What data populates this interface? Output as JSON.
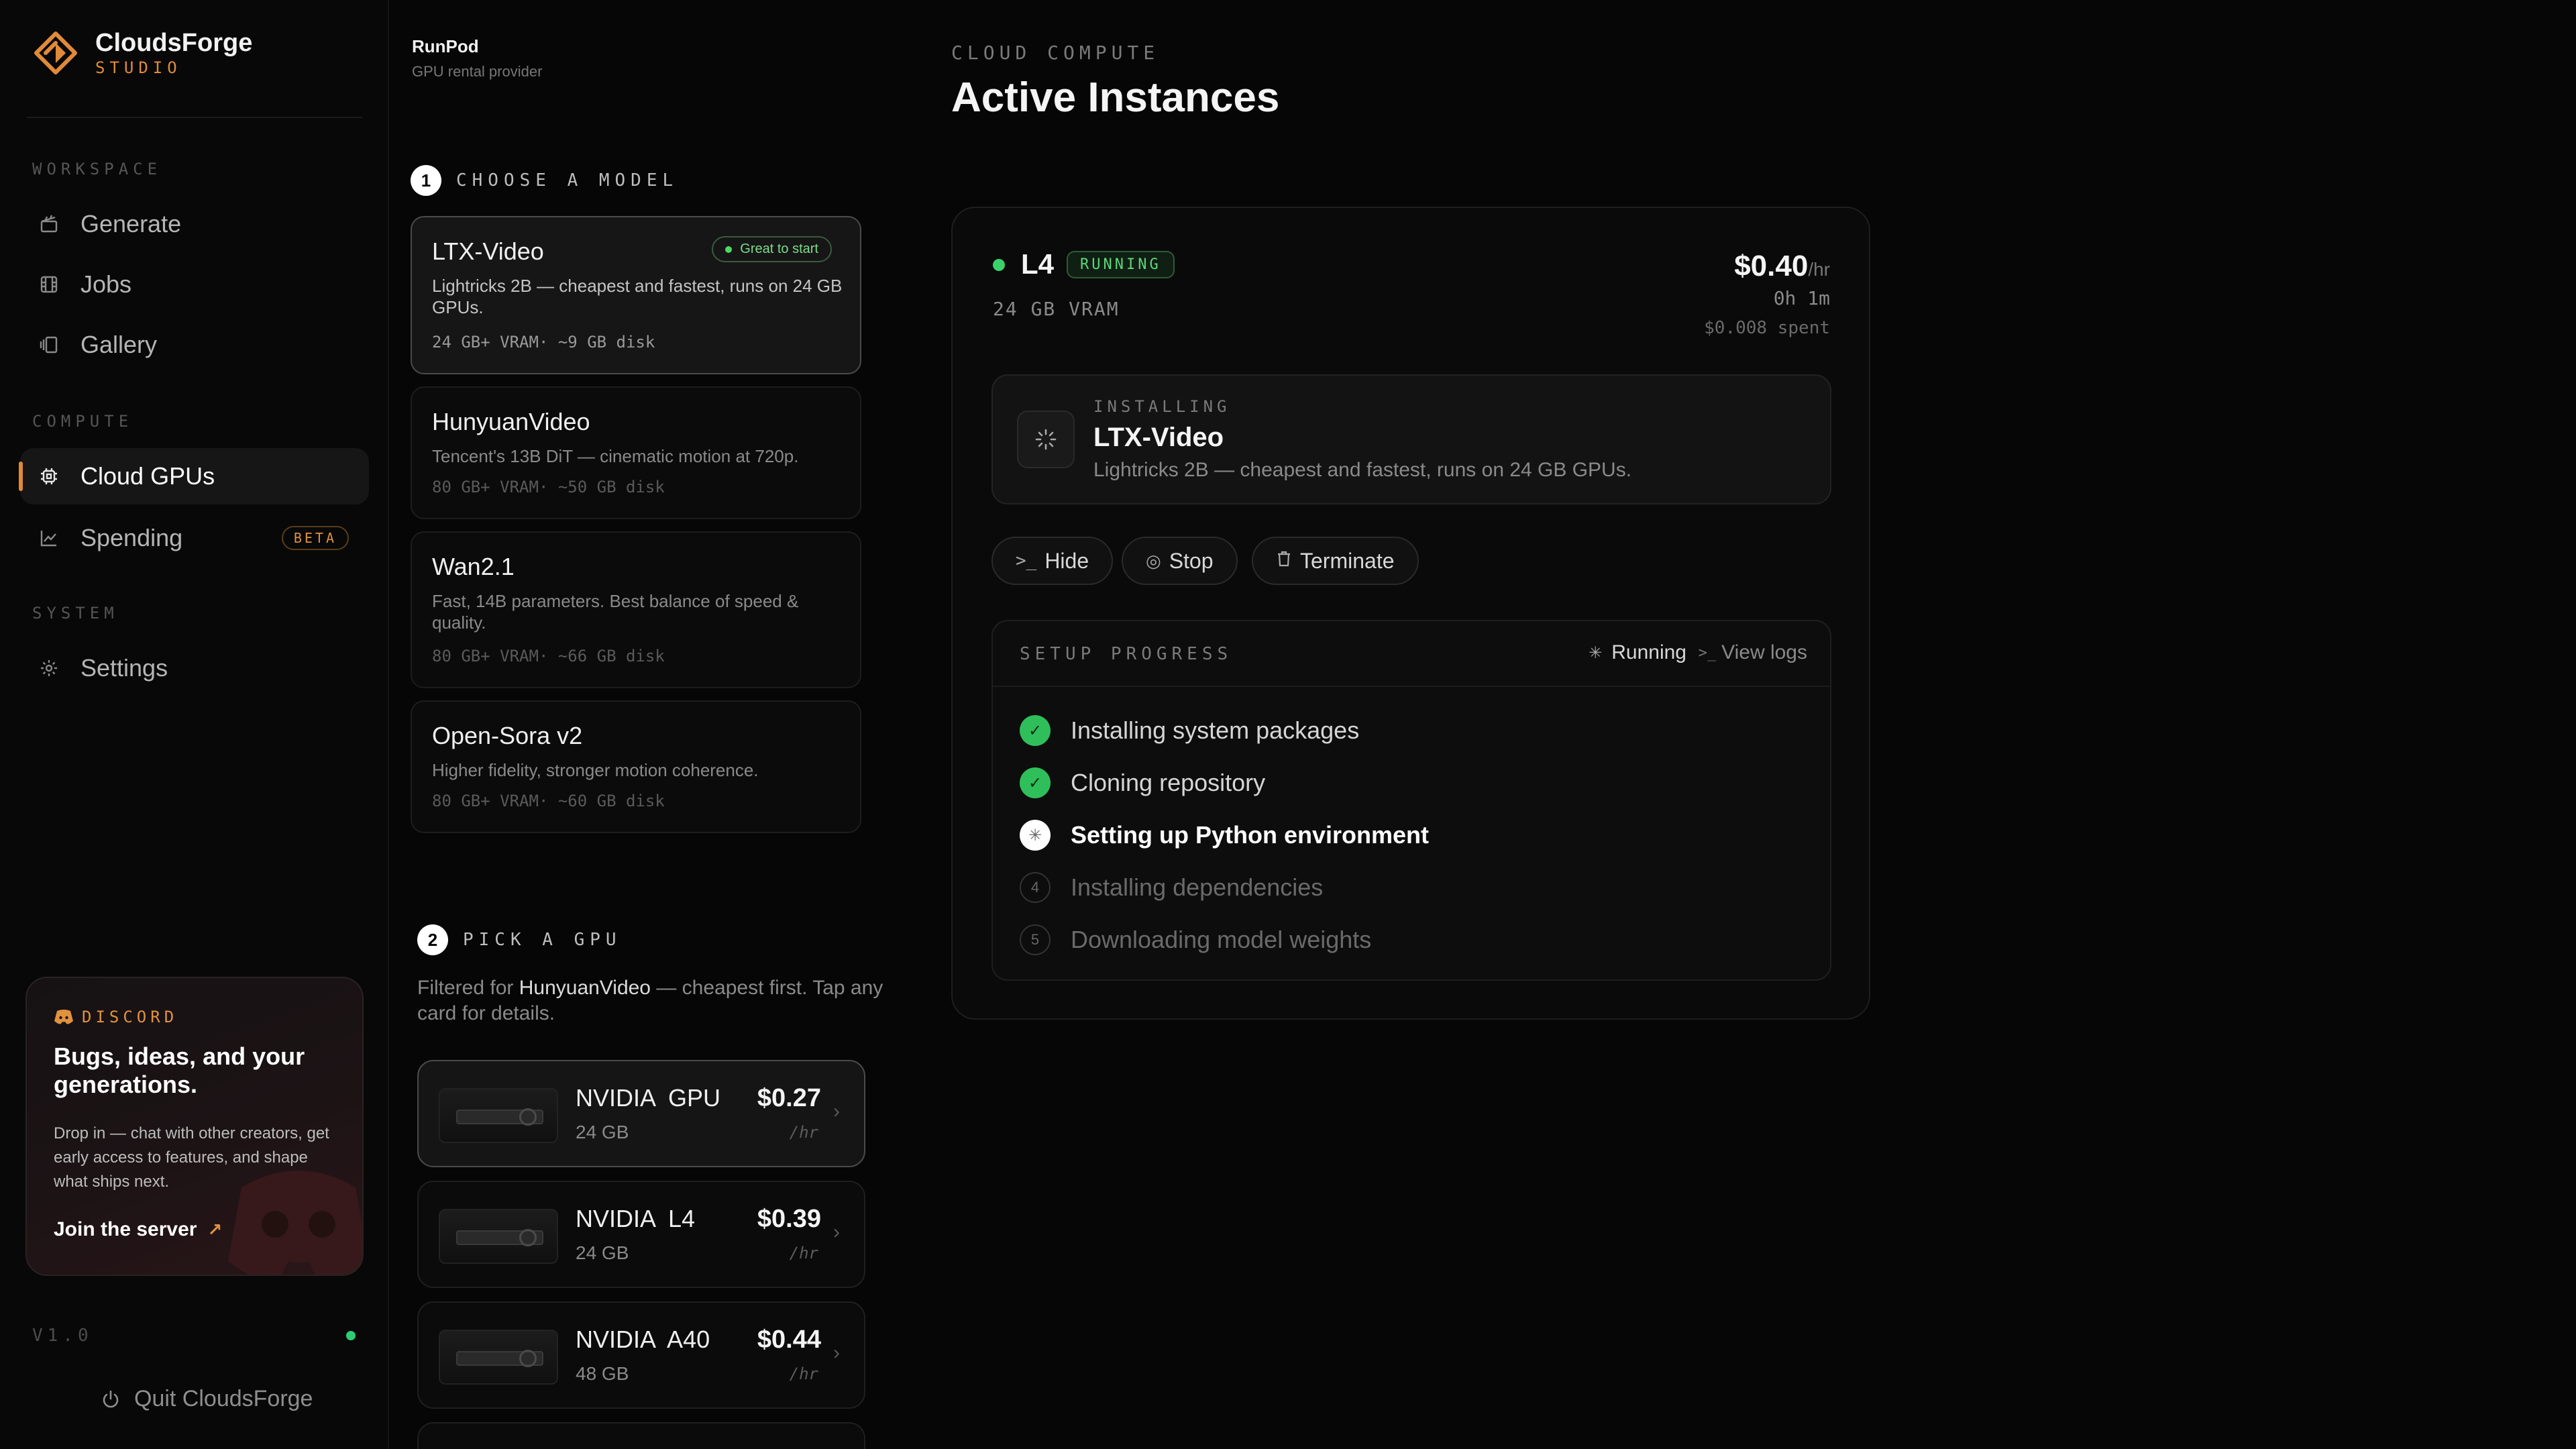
{
  "brand": {
    "name": "CloudsForge",
    "sub": "STUDIO"
  },
  "nav": {
    "workspace_label": "WORKSPACE",
    "generate": "Generate",
    "jobs": "Jobs",
    "gallery": "Gallery",
    "compute_label": "COMPUTE",
    "cloud_gpus": "Cloud GPUs",
    "spending": "Spending",
    "spending_badge": "BETA",
    "system_label": "SYSTEM",
    "settings": "Settings"
  },
  "discord": {
    "tag": "DISCORD",
    "title": "Bugs, ideas, and your generations.",
    "body": "Drop in — chat with other creators, get early access to features, and shape what ships next.",
    "cta": "Join the server"
  },
  "footer": {
    "version": "V1.0",
    "quit": "Quit CloudsForge"
  },
  "provider": {
    "name": "RunPod",
    "sub": "GPU rental provider"
  },
  "step1": {
    "num": "1",
    "label": "CHOOSE A MODEL"
  },
  "models": [
    {
      "name": "LTX-Video",
      "badge": "Great to start",
      "desc": "Lightricks 2B — cheapest and fastest, runs on 24 GB GPUs.",
      "spec": "24 GB+ VRAM· ~9 GB disk"
    },
    {
      "name": "HunyuanVideo",
      "desc": "Tencent's 13B DiT — cinematic motion at 720p.",
      "spec": "80 GB+ VRAM· ~50 GB disk"
    },
    {
      "name": "Wan2.1",
      "desc": "Fast, 14B parameters. Best balance of speed & quality.",
      "spec": "80 GB+ VRAM· ~66 GB disk"
    },
    {
      "name": "Open-Sora v2",
      "desc": "Higher fidelity, stronger motion coherence.",
      "spec": "80 GB+ VRAM· ~60 GB disk"
    }
  ],
  "step2": {
    "num": "2",
    "label": "PICK A GPU",
    "filter_prefix": "Filtered for ",
    "filter_model": "HunyuanVideo",
    "filter_suffix": " — cheapest first. Tap any card for details."
  },
  "gpus": [
    {
      "name": "NVIDIA GPU",
      "mem": "24 GB",
      "price": "$0.27",
      "unit": "/hr"
    },
    {
      "name": "NVIDIA L4",
      "mem": "24 GB",
      "price": "$0.39",
      "unit": "/hr"
    },
    {
      "name": "NVIDIA A40",
      "mem": "48 GB",
      "price": "$0.44",
      "unit": "/hr"
    }
  ],
  "main": {
    "eyebrow": "CLOUD COMPUTE",
    "title": "Active Instances"
  },
  "instance": {
    "name": "L4",
    "status": "RUNNING",
    "vram": "24 GB VRAM",
    "price": "$0.40",
    "price_unit": "/hr",
    "uptime": "0h 1m",
    "spent": "$0.008 spent",
    "install_label": "INSTALLING",
    "install_name": "LTX-Video",
    "install_desc": "Lightricks 2B — cheapest and fastest, runs on 24 GB GPUs.",
    "btn_hide": "Hide",
    "btn_stop": "Stop",
    "btn_terminate": "Terminate"
  },
  "progress": {
    "title": "SETUP PROGRESS",
    "status": "Running",
    "logs": "View logs",
    "steps": [
      {
        "label": "Installing system packages",
        "state": "done"
      },
      {
        "label": "Cloning repository",
        "state": "done"
      },
      {
        "label": "Setting up Python environment",
        "state": "active"
      },
      {
        "label": "Installing dependencies",
        "state": "pending",
        "num": "4"
      },
      {
        "label": "Downloading model weights",
        "state": "pending",
        "num": "5"
      }
    ]
  },
  "colors": {
    "accent": "#e08a3a",
    "success": "#2fbf5a",
    "background": "#060606"
  }
}
